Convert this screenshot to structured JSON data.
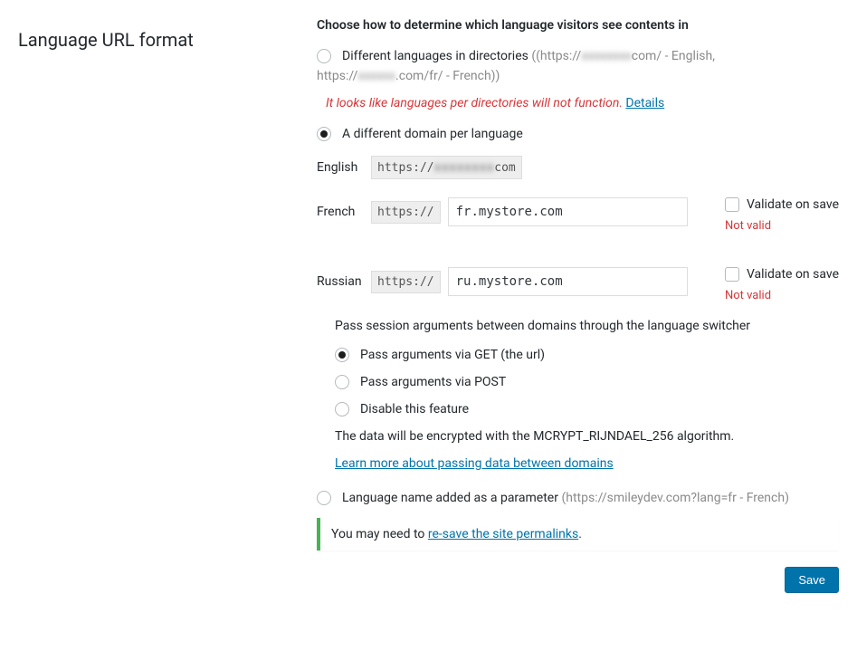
{
  "left": {
    "title": "Language URL format"
  },
  "heading": "Choose how to determine which language visitors see contents in",
  "option1": {
    "label": "Different languages in directories",
    "hint_open": "((https://",
    "hint_blur1": "xxxxxxxx",
    "hint_mid": "com/ - English,",
    "hint_line2_pre": "https://",
    "hint_blur2": "xxxxxx",
    "hint_line2_post": ".com/fr/ - French))"
  },
  "warning": {
    "text": "It looks like languages per directories will not function.",
    "link": "Details"
  },
  "option2": {
    "label": "A different domain per language"
  },
  "english": {
    "label": "English",
    "scheme": "https://",
    "domain_blur": "xxxxxxxx",
    "tld": "com"
  },
  "french": {
    "label": "French",
    "scheme": "https://",
    "value": "fr.mystore.com",
    "validate_label": "Validate on save",
    "status": "Not valid"
  },
  "russian": {
    "label": "Russian",
    "scheme": "https://",
    "value": "ru.mystore.com",
    "validate_label": "Validate on save",
    "status": "Not valid"
  },
  "pass": {
    "heading": "Pass session arguments between domains through the language switcher",
    "opt_get": "Pass arguments via GET (the url)",
    "opt_post": "Pass arguments via POST",
    "opt_disable": "Disable this feature",
    "encrypt": "The data will be encrypted with the MCRYPT_RIJNDAEL_256 algorithm.",
    "learn": "Learn more about passing data between domains"
  },
  "option3": {
    "label": "Language name added as a parameter",
    "hint": "(https://smileydev.com?lang=fr - French)"
  },
  "notice": {
    "pre": "You may need to ",
    "link": "re-save the site permalinks",
    "post": "."
  },
  "save": "Save"
}
